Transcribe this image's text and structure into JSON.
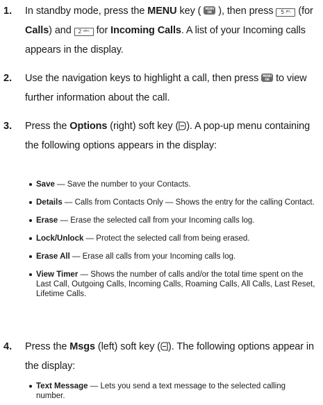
{
  "steps": [
    {
      "num": "1.",
      "parts": {
        "a": "In standby mode, press the ",
        "b_menu": "MENU",
        "c": " key ( ",
        "d": " ), then press ",
        "key5": "5 ᴶᴷᴸ",
        "e": " (for ",
        "b_calls": "Calls",
        "f": ") and ",
        "key2": "2 ᵃᵇᶜ",
        "g": " for ",
        "b_incoming": "Incoming Calls",
        "h": ". A list of your Incoming calls appears in the display."
      }
    },
    {
      "num": "2.",
      "parts": {
        "a": "Use the navigation keys to highlight a call, then press ",
        "b": " to view further information about the call."
      }
    },
    {
      "num": "3.",
      "parts": {
        "a": "Press the ",
        "b_options": "Options",
        "c": " (right) soft key (",
        "d": "). A pop-up menu containing the following options appears in the display:"
      },
      "bullets": [
        {
          "term": "Save",
          "text": " — Save the number to your Contacts."
        },
        {
          "term": "Details",
          "text": " — Calls from Contacts Only — Shows the entry for the calling Contact."
        },
        {
          "term": "Erase",
          "text": " — Erase the selected call from your Incoming calls log."
        },
        {
          "term": "Lock/Unlock",
          "text": " — Protect the selected call from being erased."
        },
        {
          "term": "Erase All",
          "text": " — Erase all calls from your Incoming calls log."
        },
        {
          "term": "View Timer",
          "text": " — Shows the number of calls and/or the total time spent on the Last Call, Outgoing Calls, Incoming Calls, Roaming Calls, All Calls, Last Reset, Lifetime Calls."
        }
      ]
    },
    {
      "num": "4.",
      "parts": {
        "a": "Press the ",
        "b_msgs": "Msgs",
        "c": " (left) soft key (",
        "d": "). The following options appear in the display:"
      },
      "bullets": [
        {
          "term": "Text Message",
          "text": " — Lets you send a text message to the selected calling number."
        }
      ]
    }
  ],
  "icons": {
    "menu_ok_key": "menu-ok-key-icon",
    "right_softkey": "right-softkey-icon",
    "left_softkey": "left-softkey-icon"
  }
}
